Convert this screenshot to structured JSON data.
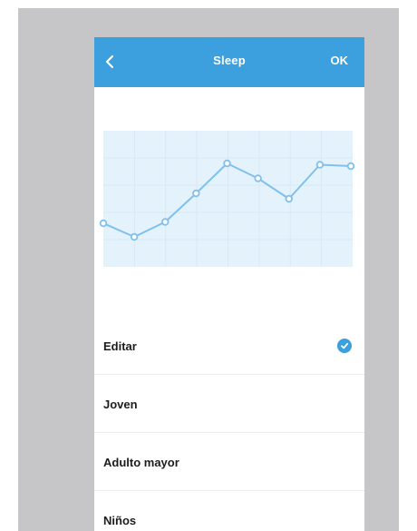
{
  "navbar": {
    "back_icon": "chevron-left-icon",
    "title": "Sleep",
    "ok_label": "OK"
  },
  "colors": {
    "accent": "#3c9fde",
    "chart_fill": "#e4f2fc",
    "line": "#7fc0ec",
    "backdrop": "#c6c6c8"
  },
  "chart_data": {
    "type": "line",
    "x": [
      0,
      1,
      2,
      3,
      4,
      5,
      6,
      7,
      8
    ],
    "values": [
      0.32,
      0.22,
      0.33,
      0.54,
      0.76,
      0.65,
      0.5,
      0.75,
      0.74
    ],
    "ylim": [
      0,
      1
    ],
    "grid": true,
    "markers": true
  },
  "list": {
    "items": [
      {
        "label": "Editar",
        "checked": true
      },
      {
        "label": "Joven",
        "checked": false
      },
      {
        "label": "Adulto mayor",
        "checked": false
      },
      {
        "label": "Niños",
        "checked": false
      }
    ]
  }
}
